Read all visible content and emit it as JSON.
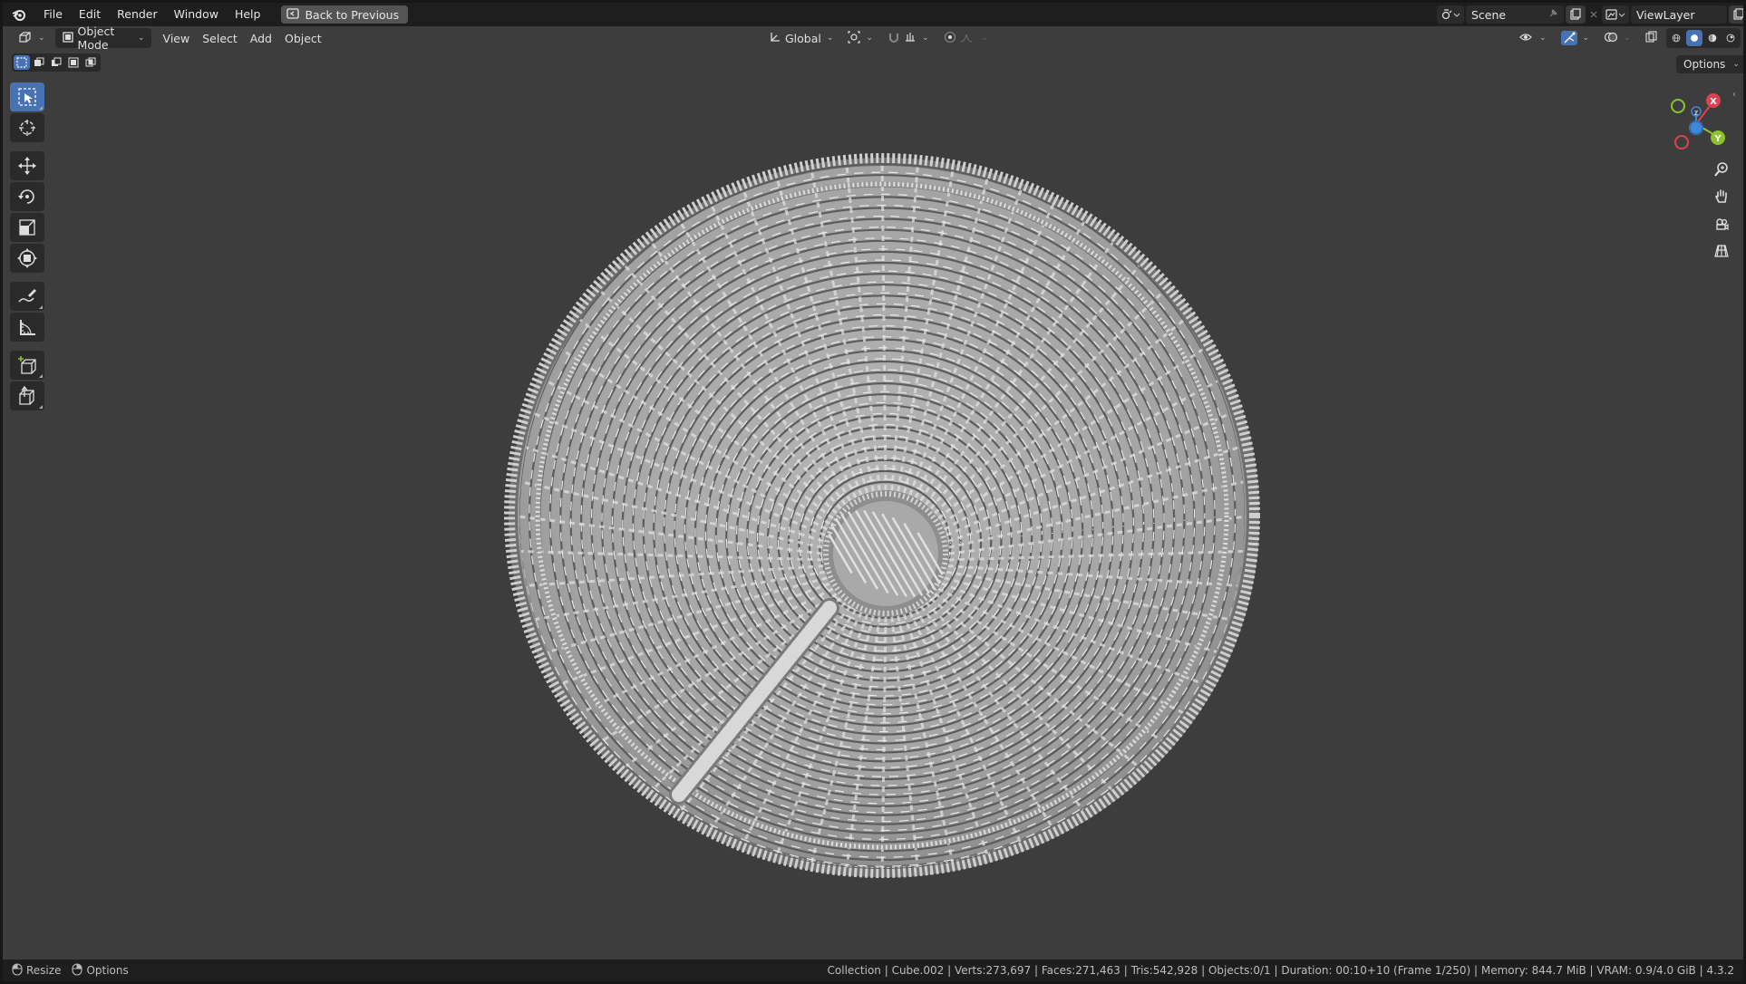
{
  "menubar": {
    "items": [
      "File",
      "Edit",
      "Render",
      "Window",
      "Help"
    ],
    "back_button": "Back to Previous",
    "scene_label": "Scene",
    "view_layer_label": "ViewLayer"
  },
  "header": {
    "mode": "Object Mode",
    "menus": [
      "View",
      "Select",
      "Add",
      "Object"
    ],
    "transform_orientation": "Global",
    "options_label": "Options"
  },
  "gizmo": {
    "x": "X",
    "y": "Y",
    "z": "Z"
  },
  "status": {
    "left_items": [
      "Resize",
      "Options"
    ],
    "right_text": "Collection | Cube.002 | Verts:273,697 | Faces:271,463 | Tris:542,928 | Objects:0/1 | Duration: 00:10+10 (Frame 1/250) | Memory: 844.7 MiB | VRAM: 0.9/4.0 GiB | 4.3.2"
  },
  "colors": {
    "accent": "#4772b3",
    "axis_x": "#e0404f",
    "axis_y": "#8ac42d",
    "axis_z": "#3f87d8"
  },
  "icons": {
    "logo": "blender-logo-icon",
    "tools": [
      "select-box-icon",
      "cursor-icon",
      "move-icon",
      "rotate-icon",
      "scale-icon",
      "transform-icon",
      "annotate-icon",
      "measure-icon",
      "add-cube-icon",
      "extrude-icon"
    ]
  }
}
